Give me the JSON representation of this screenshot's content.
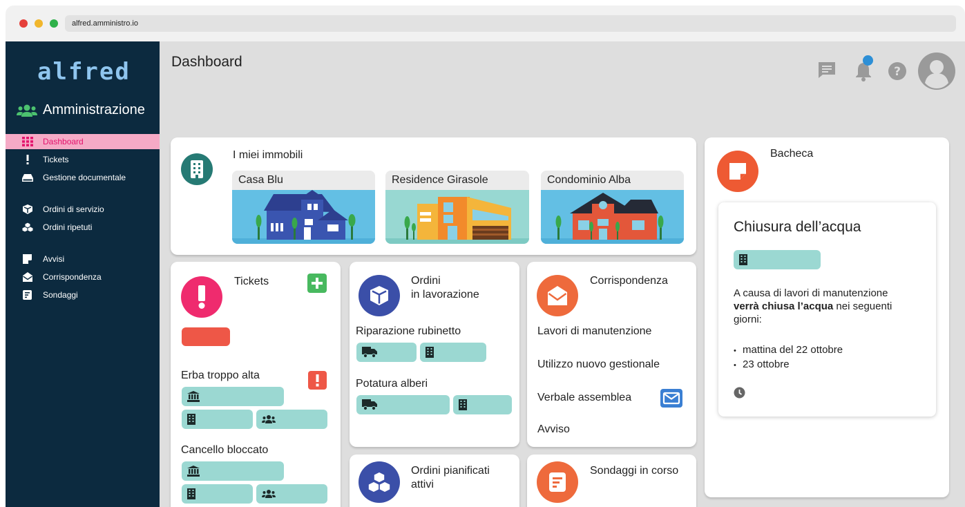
{
  "browser": {
    "url": "alfred.amministro.io"
  },
  "sidebar": {
    "logo": "alfred",
    "section": "Amministrazione",
    "items": [
      {
        "label": "Dashboard",
        "icon": "grid-icon",
        "active": true
      },
      {
        "label": "Tickets",
        "icon": "exclamation-icon"
      },
      {
        "label": "Gestione documentale",
        "icon": "drive-icon"
      },
      {
        "label": "Ordini di servizio",
        "icon": "box-icon"
      },
      {
        "label": "Ordini ripetuti",
        "icon": "boxes-icon"
      },
      {
        "label": "Avvisi",
        "icon": "note-icon"
      },
      {
        "label": "Corrispondenza",
        "icon": "envelope-open-icon"
      },
      {
        "label": "Sondaggi",
        "icon": "poll-icon"
      }
    ]
  },
  "header": {
    "title": "Dashboard"
  },
  "colors": {
    "sidebar": "#0c2a3f",
    "active": "#e3126c",
    "teal": "#9bd8d2",
    "red": "#ee5747",
    "blue": "#3b4fa8",
    "orange": "#ee6a3c"
  },
  "immobili": {
    "title": "I miei immobili",
    "properties": [
      {
        "name": "Casa Blu"
      },
      {
        "name": "Residence Girasole"
      },
      {
        "name": "Condominio Alba"
      }
    ]
  },
  "tickets": {
    "title": "Tickets",
    "items": [
      {
        "label": "Erba troppo alta"
      },
      {
        "label": "Cancello bloccato"
      }
    ]
  },
  "ordini": {
    "title_line1": "Ordini",
    "title_line2": "in lavorazione",
    "items": [
      {
        "label": "Riparazione rubinetto"
      },
      {
        "label": "Potatura alberi"
      }
    ]
  },
  "corrispondenza": {
    "title": "Corrispondenza",
    "items": [
      {
        "label": "Lavori di manutenzione"
      },
      {
        "label": "Utilizzo nuovo gestionale"
      },
      {
        "label": "Verbale assemblea"
      },
      {
        "label": "Avviso"
      }
    ]
  },
  "pianificati": {
    "title_line1": "Ordini pianificati",
    "title_line2": "attivi"
  },
  "sondaggi": {
    "title": "Sondaggi in corso"
  },
  "bacheca": {
    "title": "Bacheca",
    "post": {
      "title": "Chiusura dell’acqua",
      "text_before": "A causa di lavori di manutenzione ",
      "text_bold": "verrà chiusa l’acqua",
      "text_after": " nei seguenti giorni:",
      "dates": [
        "mattina del 22 ottobre",
        "23 ottobre"
      ]
    }
  }
}
